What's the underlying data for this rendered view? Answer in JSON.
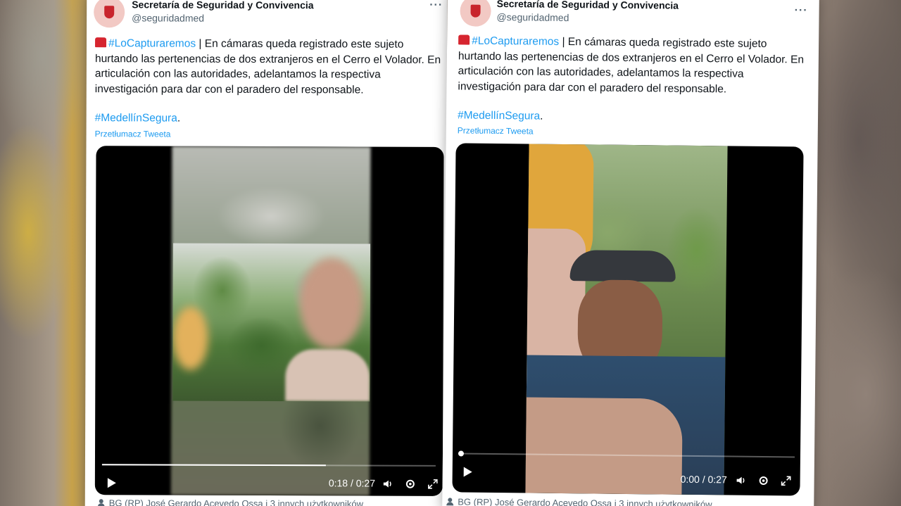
{
  "posts": [
    {
      "author_name": "Secretaría de Seguridad y Convivencia",
      "author_handle": "@seguridadmed",
      "more_label": "···",
      "hashtag1": "#LoCapturaremos",
      "body_text": " | En cámaras queda registrado este sujeto hurtando las pertenencias de dos extranjeros en el Cerro el Volador. En articulación con las autoridades, adelantamos la respectiva investigación para dar con el paradero del responsable.",
      "hashtag2": "#MedellínSegura",
      "hashtag2_suffix": ".",
      "translate_label": "Przetłumacz Tweeta",
      "video": {
        "time": "0:18 / 0:27",
        "progress": 0.67
      },
      "footer": "BG (RP) José Gerardo Acevedo Ossa i 3 innych użytkowników"
    },
    {
      "author_name": "Secretaría de Seguridad y Convivencia",
      "author_handle": "@seguridadmed",
      "more_label": "···",
      "hashtag1": "#LoCapturaremos",
      "body_text": " | En cámaras queda registrado este sujeto hurtando las pertenencias de dos extranjeros en el Cerro el Volador. En articulación con las autoridades, adelantamos la respectiva investigación para dar con el paradero del responsable.",
      "hashtag2": "#MedellínSegura",
      "hashtag2_suffix": ".",
      "translate_label": "Przetłumacz Tweeta",
      "video": {
        "time": "0:00 / 0:27",
        "progress": 0.0
      },
      "footer": "BG (RP) José Gerardo Acevedo Ossa i 3 innych użytkowników"
    }
  ],
  "colors": {
    "link": "#1d9bf0",
    "text": "#0f1419",
    "muted": "#536471"
  },
  "icons": [
    "siren-icon",
    "play-icon",
    "speaker-icon",
    "gear-icon",
    "fullscreen-icon",
    "person-icon",
    "more-icon"
  ]
}
